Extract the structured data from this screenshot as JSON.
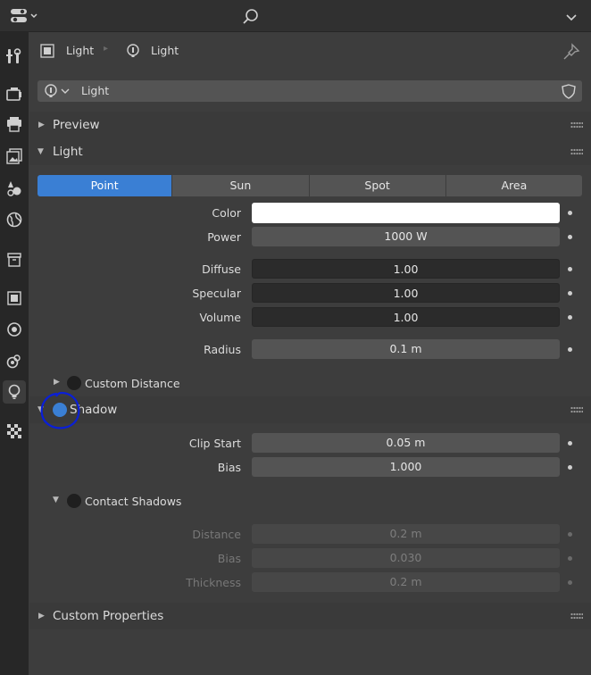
{
  "header": {
    "editor_type_icon": "properties-editor-icon",
    "search_icon": "search-icon",
    "menu_chevron_icon": "chevron-down-icon"
  },
  "breadcrumb": {
    "object_name": "Light",
    "data_name": "Light"
  },
  "datablock": {
    "name": "Light"
  },
  "panels": {
    "preview": "Preview",
    "light": "Light",
    "shadow": "Shadow",
    "custom_properties": "Custom Properties"
  },
  "light_types": [
    "Point",
    "Sun",
    "Spot",
    "Area"
  ],
  "selected_light_type": "Point",
  "light_props": {
    "color_label": "Color",
    "power_label": "Power",
    "power_value": "1000 W",
    "diffuse_label": "Diffuse",
    "diffuse_value": "1.00",
    "specular_label": "Specular",
    "specular_value": "1.00",
    "volume_label": "Volume",
    "volume_value": "1.00",
    "radius_label": "Radius",
    "radius_value": "0.1 m",
    "custom_distance_label": "Custom Distance"
  },
  "shadow_props": {
    "clip_start_label": "Clip Start",
    "clip_start_value": "0.05 m",
    "bias_label": "Bias",
    "bias_value": "1.000",
    "contact_shadows_label": "Contact Shadows",
    "distance_label": "Distance",
    "distance_value": "0.2 m",
    "contact_bias_label": "Bias",
    "contact_bias_value": "0.030",
    "thickness_label": "Thickness",
    "thickness_value": "0.2 m"
  },
  "colors": {
    "accent": "#3a7fd4",
    "color_swatch": "#ffffff",
    "annotation_circle": "#0a1fd6"
  }
}
